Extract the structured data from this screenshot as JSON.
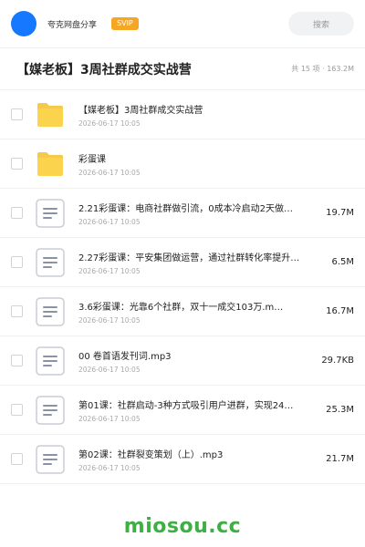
{
  "topbar": {
    "user_name": "夸克网盘分享",
    "badge": "SVIP",
    "search_placeholder": "搜索",
    "avatar_color": "#1677ff",
    "badge_color": "#f5a623"
  },
  "header": {
    "title": "【媒老板】3周社群成交实战营",
    "meta": "共 15 项 · 163.2M"
  },
  "files": [
    {
      "type": "folder",
      "icon": "folder-icon",
      "name": "【媒老板】3周社群成交实战营",
      "date": "2026-06-17 10:05",
      "size": ""
    },
    {
      "type": "folder",
      "icon": "folder-icon",
      "name": "彩蛋课",
      "date": "2026-06-17 10:05",
      "size": ""
    },
    {
      "type": "file",
      "icon": "document-icon",
      "name": "2.21彩蛋课：电商社群做引流，0成本冷启动2天做…",
      "date": "2026-06-17 10:05",
      "size": "19.7M"
    },
    {
      "type": "file",
      "icon": "document-icon",
      "name": "2.27彩蛋课：平安集团做运营，通过社群转化率提升…",
      "date": "2026-06-17 10:05",
      "size": "6.5M"
    },
    {
      "type": "file",
      "icon": "document-icon",
      "name": "3.6彩蛋课：光靠6个社群，双十一成交103万.m…",
      "date": "2026-06-17 10:05",
      "size": "16.7M"
    },
    {
      "type": "file",
      "icon": "document-icon",
      "name": "00 卷首语发刊词.mp3",
      "date": "2026-06-17 10:05",
      "size": "29.7KB"
    },
    {
      "type": "file",
      "icon": "document-icon",
      "name": "第01课：社群启动-3种方式吸引用户进群，实现24…",
      "date": "2026-06-17 10:05",
      "size": "25.3M"
    },
    {
      "type": "file",
      "icon": "document-icon",
      "name": "第02课：社群裂变策划（上）.mp3",
      "date": "2026-06-17 10:05",
      "size": "21.7M"
    }
  ],
  "watermark": {
    "text": "miosou.cc",
    "color": "#3cb043"
  }
}
